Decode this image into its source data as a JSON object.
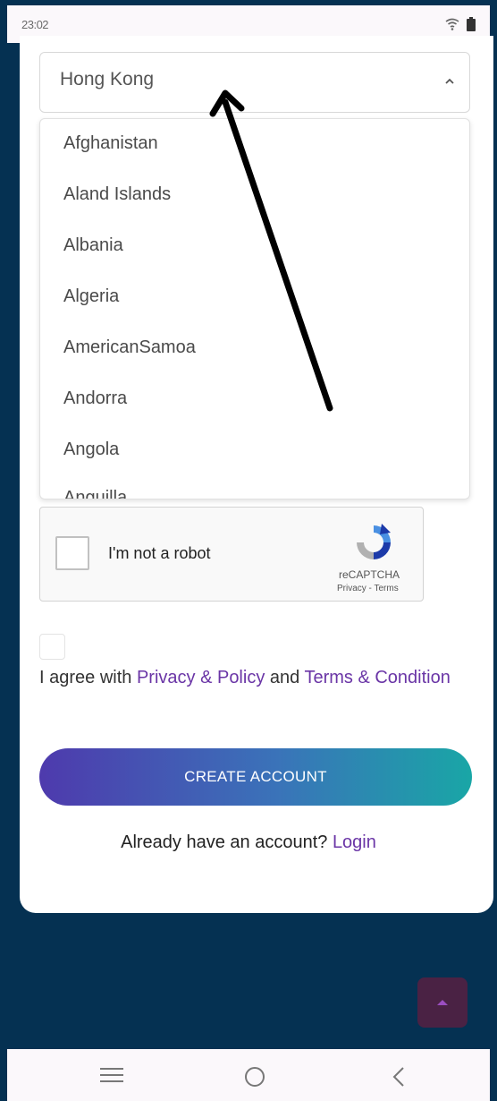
{
  "status_bar": {
    "time": "23:02",
    "icons": [
      "wifi-icon",
      "battery-icon"
    ]
  },
  "country_select": {
    "selected": "Hong Kong",
    "icon": "chevron-up-icon",
    "options": [
      "Afghanistan",
      "Aland Islands",
      "Albania",
      "Algeria",
      "AmericanSamoa",
      "Andorra",
      "Angola",
      "Anguilla"
    ]
  },
  "recaptcha": {
    "label": "I'm not a robot",
    "brand": "reCAPTCHA",
    "links": "Privacy - Terms"
  },
  "agree": {
    "prefix": "I agree with ",
    "privacy_link": "Privacy & Policy",
    "middle": " and ",
    "terms_link": "Terms & Condition"
  },
  "create_account_label": "CREATE ACCOUNT",
  "login_prompt": {
    "text": "Already have an account? ",
    "link": "Login"
  },
  "colors": {
    "background": "#053152",
    "link": "#6a35a6",
    "button_gradient_start": "#4e3aad",
    "button_gradient_end": "#19a6a6"
  }
}
